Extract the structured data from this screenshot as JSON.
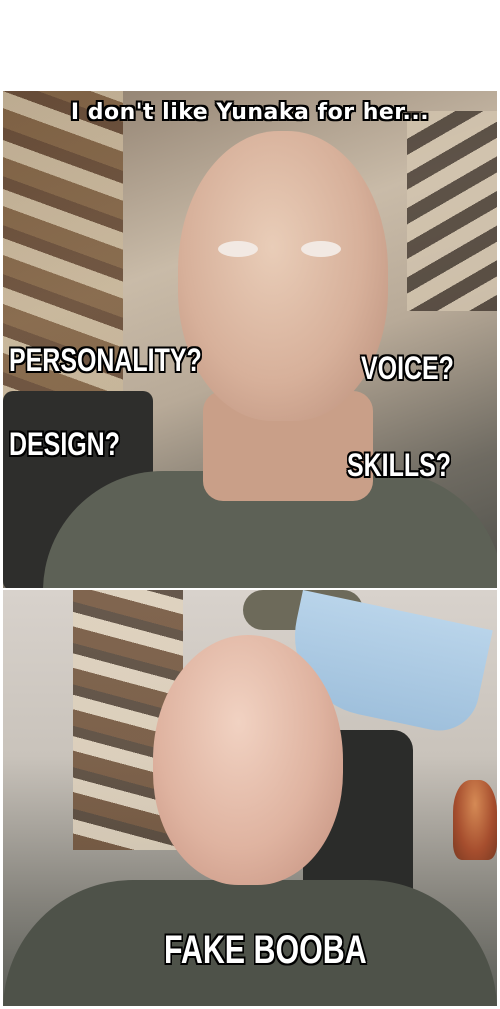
{
  "meme": {
    "top_caption": "I don't like Yunaka for her...",
    "labels": {
      "personality": "PERSONALITY?",
      "voice": "VOICE?",
      "design": "DESIGN?",
      "skills": "SKILLS?"
    },
    "bottom_caption": "FAKE BOOBA"
  },
  "colors": {
    "text_fill": "#ffffff",
    "text_outline": "#000000",
    "background": "#ffffff"
  }
}
